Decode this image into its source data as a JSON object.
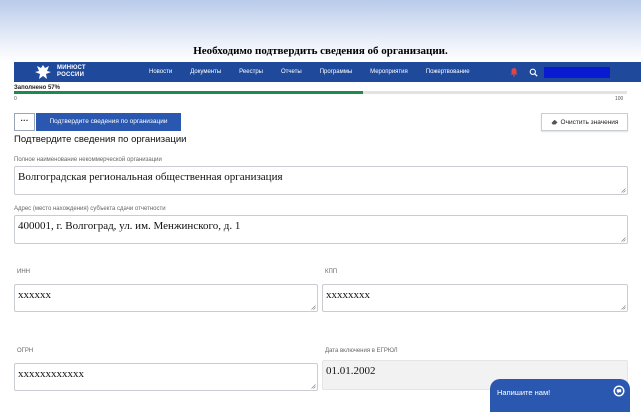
{
  "banner": {
    "text": "Необходимо подтвердить сведения об организации."
  },
  "nav": {
    "logo_line1": "МИНЮСТ",
    "logo_line2": "РОССИИ",
    "items": [
      "Новости",
      "Документы",
      "Реестры",
      "Отчеты",
      "Программы",
      "Мероприятия",
      "Пожертвование"
    ]
  },
  "progress": {
    "label": "Заполнено 57%",
    "value": 57,
    "min_label": "0",
    "max_label": "100",
    "color": "#1e8a4c"
  },
  "toolbar": {
    "more_label": "···",
    "confirm_label": "Подтвердите сведения по организации",
    "clear_label": "Очистить значения"
  },
  "section": {
    "title": "Подтвердите сведения по организации"
  },
  "fields": {
    "full_name": {
      "label": "Полное наименование некоммерческой организации",
      "value": "Волгоградская региональная общественная организация"
    },
    "address": {
      "label": "Адрес (место нахождения) субъекта сдачи отчетности",
      "value": "400001, г. Волгоград, ул. им. Менжинского, д. 1"
    },
    "inn": {
      "label": "ИНН",
      "value": "xxxxxx"
    },
    "kpp": {
      "label": "КПП",
      "value": "xxxxxxxx"
    },
    "ogrn": {
      "label": "ОГРН",
      "value": "xxxxxxxxxxxx"
    },
    "egrul_date": {
      "label": "Дата включения в ЕГРЮЛ",
      "value": "01.01.2002"
    }
  },
  "chat": {
    "label": "Напишите нам!"
  },
  "colors": {
    "nav": "#1f4a9c",
    "primary": "#2a58b0",
    "search_block": "#0a1ad0"
  }
}
